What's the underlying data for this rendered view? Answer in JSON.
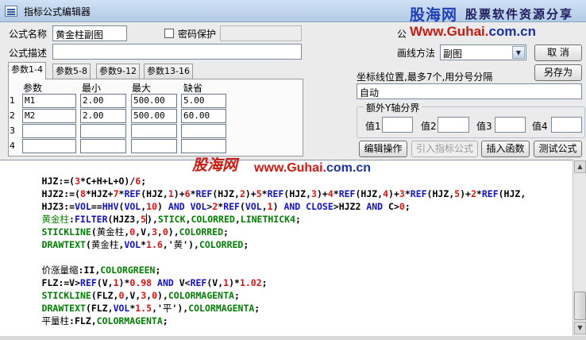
{
  "window": {
    "title": "指标公式编辑器"
  },
  "watermarks": {
    "logo": "股海网",
    "tagline": "股票软件资源分享",
    "url_www": "Www.Guhai.",
    "url_dom": "com.cn",
    "mid_logo": "股海网",
    "mid_url_www": "www.Guhai.",
    "mid_url_dom": "com.cn"
  },
  "form": {
    "name_label": "公式名称",
    "name_value": "黄金柱副图",
    "password_label": "密码保护",
    "password_value": "",
    "desc_label": "公式描述",
    "desc_value": "",
    "type_label_partial": "公",
    "draw_method_label": "画线方法",
    "draw_method_value": "副图"
  },
  "buttons": {
    "cancel": "取  消",
    "save_as": "另存为",
    "edit_ops": "编辑操作",
    "import_formula": "引入指标公式",
    "insert_function": "插入函数",
    "test_formula": "测试公式"
  },
  "param_tabs": [
    "参数1-4",
    "参数5-8",
    "参数9-12",
    "参数13-16"
  ],
  "param_headers": [
    "参数",
    "最小",
    "最大",
    "缺省"
  ],
  "params": [
    {
      "num": "1",
      "name": "M1",
      "min": "2.00",
      "max": "500.00",
      "def": "5.00"
    },
    {
      "num": "2",
      "name": "M2",
      "min": "2.00",
      "max": "500.00",
      "def": "60.00"
    },
    {
      "num": "3",
      "name": "",
      "min": "",
      "max": "",
      "def": ""
    },
    {
      "num": "4",
      "name": "",
      "min": "",
      "max": "",
      "def": ""
    }
  ],
  "axis": {
    "label": "坐标线位置,最多7个,用分号分隔",
    "value": "自动",
    "extra_title": "额外Y轴分界",
    "values": [
      {
        "label": "值1",
        "value": ""
      },
      {
        "label": "值2",
        "value": ""
      },
      {
        "label": "值3",
        "value": ""
      },
      {
        "label": "值4",
        "value": ""
      }
    ]
  },
  "code": {
    "l1": [
      "HJZ:=(",
      "3",
      "*C+H+L+O)/",
      "6",
      ";"
    ],
    "l2": [
      "HJZ2:=(",
      "8",
      "*HJZ+",
      "7",
      "*",
      "REF",
      "(HJZ,",
      "1",
      ")+",
      "6",
      "*",
      "REF",
      "(HJZ,",
      "2",
      ")+",
      "5",
      "*",
      "REF",
      "(HJZ,",
      "3",
      ")+",
      "4",
      "*",
      "REF",
      "(HJZ,",
      "4",
      ")+",
      "3",
      "*",
      "REF",
      "(HJZ,",
      "5",
      ")+",
      "2",
      "*",
      "REF",
      "(HJZ,"
    ],
    "l3": [
      "HJZ3:=",
      "VOL",
      "==",
      "HHV",
      "(",
      "VOL",
      ",",
      "10",
      ") ",
      "AND",
      " ",
      "VOL",
      ">",
      "2",
      "*",
      "REF",
      "(",
      "VOL",
      ",",
      "1",
      ") ",
      "AND",
      " ",
      "CLOSE",
      ">HJZ2 ",
      "AND",
      " C>",
      "0",
      ";"
    ],
    "l4": [
      "黄金柱",
      ":",
      "FILTER",
      "(HJZ3,",
      "5",
      "),",
      "STICK",
      ",",
      "COLORRED",
      ",",
      "LINETHICK4",
      ";"
    ],
    "l5": [
      "STICKLINE",
      "(",
      "黄金柱",
      ",",
      "0",
      ",V,",
      "3",
      ",",
      "0",
      "),",
      "COLORRED",
      ";"
    ],
    "l6": [
      "DRAWTEXT",
      "(",
      "黄金柱",
      ",",
      "VOL",
      "*",
      "1.6",
      ",'",
      "黄",
      "'),",
      "COLORRED",
      ";"
    ],
    "l7": [
      "价涨量缩",
      ":II,",
      "COLORGREEN",
      ";"
    ],
    "l8": [
      "FLZ:=V>",
      "REF",
      "(V,",
      "1",
      ")*",
      "0.98",
      " ",
      "AND",
      " V<",
      "REF",
      "(V,",
      "1",
      ")*",
      "1.02",
      ";"
    ],
    "l9": [
      "STICKLINE",
      "(FLZ,",
      "0",
      ",V,",
      "3",
      ",",
      "0",
      "),",
      "COLORMAGENTA",
      ";"
    ],
    "l10": [
      "DRAWTEXT",
      "(FLZ,",
      "VOL",
      "*",
      "1.5",
      ",'",
      "平",
      "'),",
      "COLORMAGENTA",
      ";"
    ],
    "l11": [
      "平量柱",
      ":FLZ,",
      "COLORMAGENTA",
      ";"
    ]
  }
}
